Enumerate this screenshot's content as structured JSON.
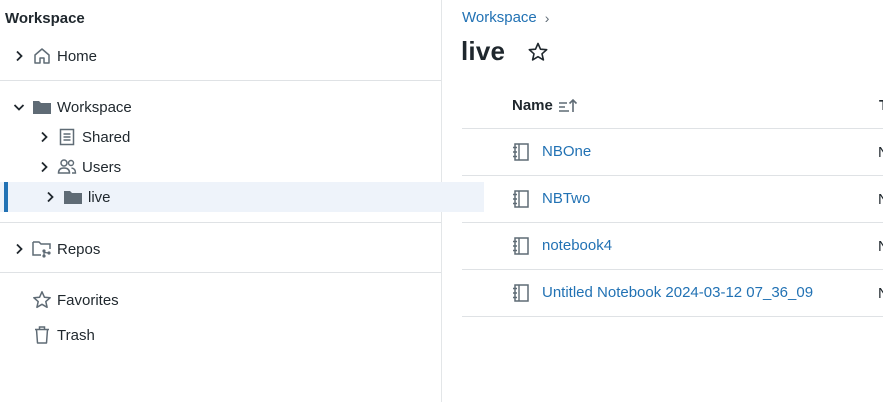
{
  "sidebar": {
    "title": "Workspace",
    "home_label": "Home",
    "workspace_label": "Workspace",
    "shared_label": "Shared",
    "users_label": "Users",
    "live_label": "live",
    "repos_label": "Repos",
    "favorites_label": "Favorites",
    "trash_label": "Trash"
  },
  "breadcrumb": {
    "workspace": "Workspace",
    "separator": "›"
  },
  "page": {
    "title": "live"
  },
  "table": {
    "header_name": "Name",
    "header_type_partial": "T",
    "rows": [
      {
        "name": "NBOne",
        "type_partial": "N"
      },
      {
        "name": "NBTwo",
        "type_partial": "N"
      },
      {
        "name": "notebook4",
        "type_partial": "N"
      },
      {
        "name": "Untitled Notebook 2024-03-12 07_36_09",
        "type_partial": "N"
      }
    ]
  },
  "colors": {
    "accent": "#2272b4",
    "text": "#1f272d",
    "icon": "#5f6b75",
    "selected_bg": "#eef3fa"
  }
}
